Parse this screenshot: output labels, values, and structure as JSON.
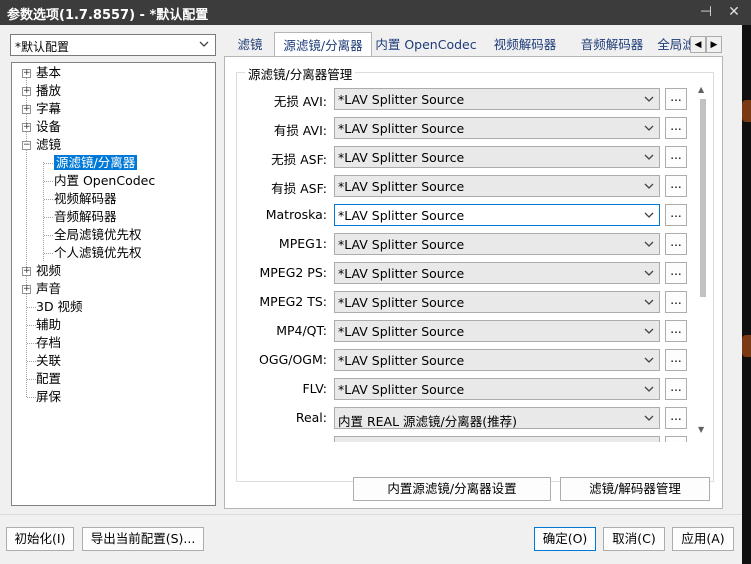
{
  "window": {
    "title": "参数选项(1.7.8557) - *默认配置",
    "pin_icon": "pin-icon",
    "close_icon": "close-icon"
  },
  "profile": {
    "selected": "*默认配置"
  },
  "tree": [
    {
      "label": "基本",
      "expander": "+"
    },
    {
      "label": "播放",
      "expander": "+"
    },
    {
      "label": "字幕",
      "expander": "+"
    },
    {
      "label": "设备",
      "expander": "+"
    },
    {
      "label": "滤镜",
      "expander": "−"
    },
    {
      "label": "源滤镜/分离器",
      "child": true,
      "selected": true
    },
    {
      "label": "内置 OpenCodec",
      "child": true
    },
    {
      "label": "视频解码器",
      "child": true
    },
    {
      "label": "音频解码器",
      "child": true
    },
    {
      "label": "全局滤镜优先权",
      "child": true
    },
    {
      "label": "个人滤镜优先权",
      "child": true
    },
    {
      "label": "视频",
      "expander": "+"
    },
    {
      "label": "声音",
      "expander": "+"
    },
    {
      "label": "3D 视频"
    },
    {
      "label": "辅助"
    },
    {
      "label": "存档"
    },
    {
      "label": "关联"
    },
    {
      "label": "配置"
    },
    {
      "label": "屏保"
    }
  ],
  "tabs": [
    "滤镜",
    "源滤镜/分离器",
    "内置 OpenCodec",
    "视频解码器",
    "音频解码器",
    "全局滤"
  ],
  "group": {
    "title": "源滤镜/分离器管理",
    "rows": [
      {
        "label": "无损 AVI:",
        "value": "*LAV Splitter Source"
      },
      {
        "label": "有损 AVI:",
        "value": "*LAV Splitter Source"
      },
      {
        "label": "无损 ASF:",
        "value": "*LAV Splitter Source"
      },
      {
        "label": "有损 ASF:",
        "value": "*LAV Splitter Source"
      },
      {
        "label": "Matroska:",
        "value": "*LAV Splitter Source"
      },
      {
        "label": "MPEG1:",
        "value": "*LAV Splitter Source"
      },
      {
        "label": "MPEG2 PS:",
        "value": "*LAV Splitter Source"
      },
      {
        "label": "MPEG2 TS:",
        "value": "*LAV Splitter Source"
      },
      {
        "label": "MP4/QT:",
        "value": "*LAV Splitter Source"
      },
      {
        "label": "OGG/OGM:",
        "value": "*LAV Splitter Source"
      },
      {
        "label": "FLV:",
        "value": "*LAV Splitter Source"
      },
      {
        "label": "Real:",
        "value": "内置 REAL 源滤镜/分离器(推荐)"
      }
    ],
    "more_button": "...",
    "builtin_settings_button": "内置源滤镜/分离器设置",
    "filter_manager_button": "滤镜/解码器管理"
  },
  "footer": {
    "init_button": "初始化(I)",
    "export_button": "导出当前配置(S)...",
    "ok_button": "确定(O)",
    "cancel_button": "取消(C)",
    "apply_button": "应用(A)"
  }
}
